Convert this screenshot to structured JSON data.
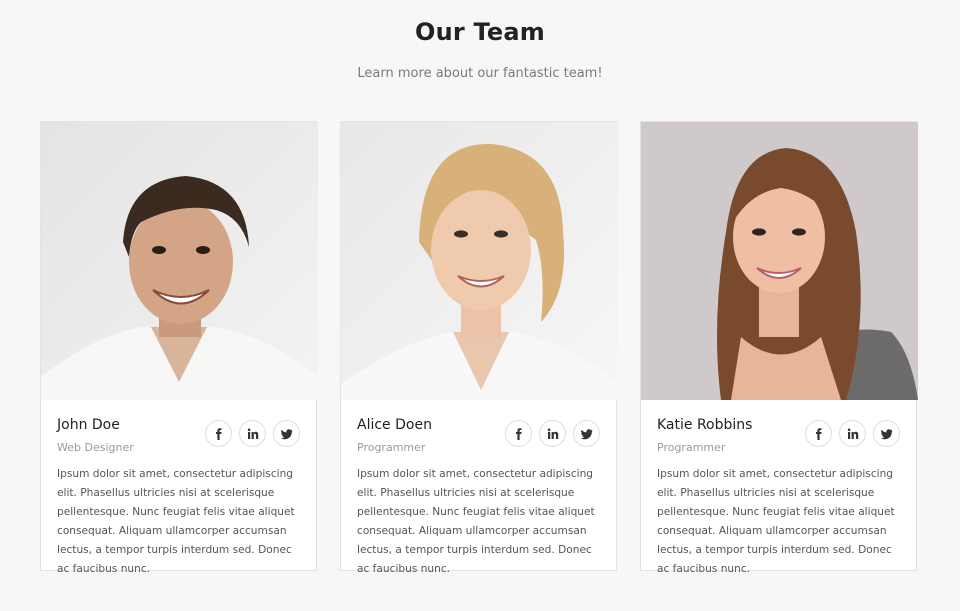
{
  "header": {
    "title": "Our Team",
    "subtitle": "Learn more about our fantastic team!"
  },
  "team": [
    {
      "name": "John Doe",
      "role": "Web Designer",
      "bio": "Ipsum dolor sit amet, consectetur adipiscing elit. Phasellus ultricies nisi at scelerisque pellentesque. Nunc feugiat felis vitae aliquet consequat. Aliquam ullamcorper accumsan lectus, a tempor turpis interdum sed. Donec ac faucibus nunc.",
      "social": [
        "facebook-icon",
        "linkedin-icon",
        "twitter-icon"
      ]
    },
    {
      "name": "Alice Doen",
      "role": "Programmer",
      "bio": "Ipsum dolor sit amet, consectetur adipiscing elit. Phasellus ultricies nisi at scelerisque pellentesque. Nunc feugiat felis vitae aliquet consequat. Aliquam ullamcorper accumsan lectus, a tempor turpis interdum sed. Donec ac faucibus nunc.",
      "social": [
        "facebook-icon",
        "linkedin-icon",
        "twitter-icon"
      ]
    },
    {
      "name": "Katie Robbins",
      "role": "Programmer",
      "bio": "Ipsum dolor sit amet, consectetur adipiscing elit. Phasellus ultricies nisi at scelerisque pellentesque. Nunc feugiat felis vitae aliquet consequat. Aliquam ullamcorper accumsan lectus, a tempor turpis interdum sed. Donec ac faucibus nunc.",
      "social": [
        "facebook-icon",
        "linkedin-icon",
        "twitter-icon"
      ]
    }
  ],
  "colors": {
    "page_background": "#f7f7f7",
    "card_background": "#ffffff",
    "heading": "#222222",
    "muted": "#9a9a9a"
  }
}
